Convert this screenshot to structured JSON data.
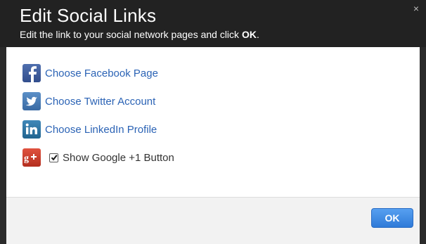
{
  "dialog": {
    "title": "Edit Social Links",
    "subtitle_prefix": "Edit the link to your social network pages and click ",
    "subtitle_bold": "OK",
    "subtitle_suffix": ".",
    "close_glyph": "×"
  },
  "links": [
    {
      "icon": "facebook-icon",
      "label": "Choose Facebook Page"
    },
    {
      "icon": "twitter-icon",
      "label": "Choose Twitter Account"
    },
    {
      "icon": "linkedin-icon",
      "label": "Choose LinkedIn Profile"
    }
  ],
  "google": {
    "icon": "google-plus-icon",
    "checkbox_label": "Show Google +1 Button",
    "checked": true
  },
  "footer": {
    "ok_label": "OK"
  },
  "colors": {
    "header_bg": "#222222",
    "link": "#2b63b5",
    "ok_button": "#3a86e0"
  }
}
